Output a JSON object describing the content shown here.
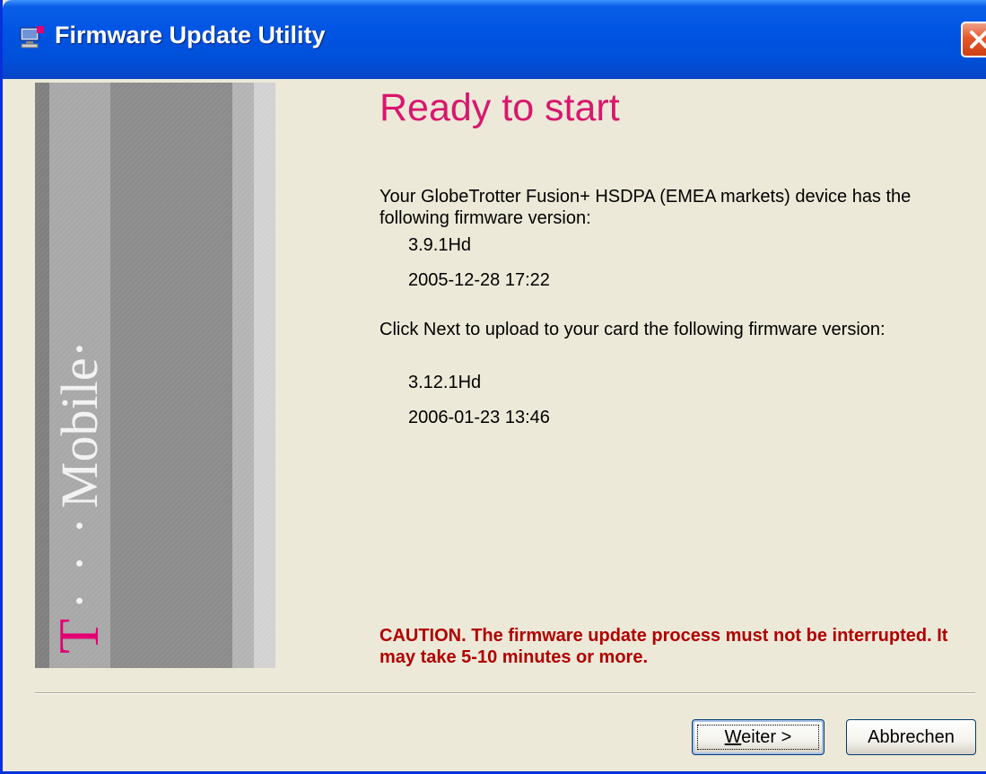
{
  "window": {
    "title": "Firmware Update Utility"
  },
  "banner": {
    "brand_t": "T",
    "brand_dots": "· · ·",
    "brand_name": "Mobile·",
    "accent_color": "#e20074"
  },
  "content": {
    "heading": "Ready to start",
    "intro": "Your GlobeTrotter Fusion+ HSDPA (EMEA markets) device has the following firmware version:",
    "current_version": "3.9.1Hd",
    "current_date": "2005-12-28 17:22",
    "next_instruction": "Click Next to upload to your card the following firmware version:",
    "new_version": "3.12.1Hd",
    "new_date": "2006-01-23 13:46",
    "caution": "CAUTION. The firmware update process must not be interrupted. It may take 5-10 minutes or more.",
    "heading_color": "#d8176e",
    "caution_color": "#b00000"
  },
  "buttons": {
    "next_label": "Weiter >",
    "cancel_label": "Abbrechen"
  },
  "icons": {
    "app": "computer-icon",
    "close": "close-icon"
  }
}
